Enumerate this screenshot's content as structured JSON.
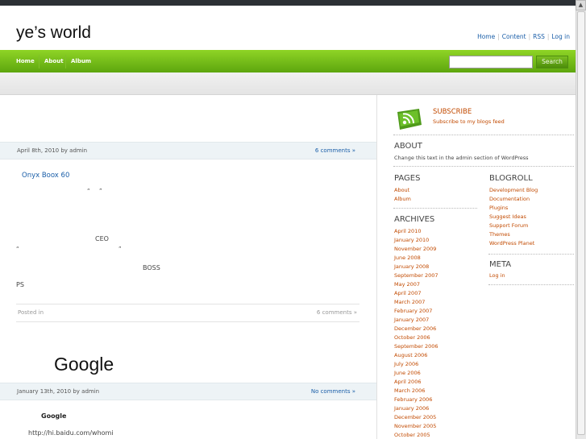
{
  "site": {
    "title": "ye’s world",
    "top_links": [
      "Home",
      "Content",
      "RSS",
      "Log in"
    ]
  },
  "nav": {
    "items": [
      "Home",
      "About",
      "Album"
    ],
    "search_placeholder": "",
    "search_button": "Search"
  },
  "posts": [
    {
      "meta": "April 8th, 2010 by admin",
      "comments": "6 comments »",
      "title_link": "Onyx Boox 60",
      "quote_mark_a": "“",
      "quote_mark_b": "”",
      "text_ceo": "CEO",
      "quote_open": "“",
      "quote_close": "”",
      "text_boss": "BOSS",
      "text_ps": "PS",
      "footer_left": "Posted in",
      "footer_right": "6 comments »"
    },
    {
      "heading": "Google",
      "meta": "January 13th, 2010 by admin",
      "comments": "No comments »",
      "subheading": "Google",
      "url_text": "http://hi.baidu.com/whomi"
    }
  ],
  "sidebar": {
    "subscribe_title": "SUBSCRIBE",
    "subscribe_sub": "Subscribe to my blogs feed",
    "about_title": "ABOUT",
    "about_text": "Change this text in the admin section of WordPress",
    "pages_title": "PAGES",
    "pages": [
      "About",
      "Album"
    ],
    "blogroll_title": "BLOGROLL",
    "blogroll": [
      "Development Blog",
      "Documentation",
      "Plugins",
      "Suggest Ideas",
      "Support Forum",
      "Themes",
      "WordPress Planet"
    ],
    "meta_title": "META",
    "meta_links": [
      "Log in"
    ],
    "archives_title": "ARCHIVES",
    "archives": [
      "April 2010",
      "January 2010",
      "November 2009",
      "June 2008",
      "January 2008",
      "September 2007",
      "May 2007",
      "April 2007",
      "March 2007",
      "February 2007",
      "January 2007",
      "December 2006",
      "October 2006",
      "September 2006",
      "August 2006",
      "July 2006",
      "June 2006",
      "April 2006",
      "March 2006",
      "February 2006",
      "January 2006",
      "December 2005",
      "November 2005",
      "October 2005"
    ]
  },
  "colors": {
    "nav_green": "#6bb516",
    "link_blue": "#1a5ea8",
    "sidebar_orange": "#c24a00"
  }
}
